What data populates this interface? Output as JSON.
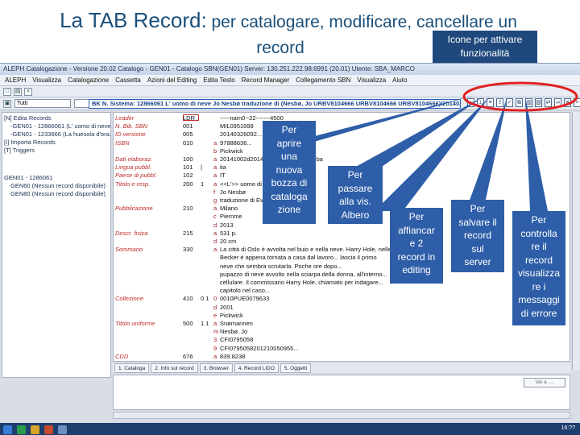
{
  "slide": {
    "title_main": "La TAB Record:",
    "title_rest": " per catalogare, modificare, cancellare un",
    "title_line2": "record",
    "icon_note": "Icone per attivare funzionalità"
  },
  "app": {
    "window_title": "ALEPH Catalogazione - Versione 20.02 Catalogo - GEN01 - Catalogo SBN(GEN01) Server: 130.251.222.98:6991 (20.01) Utente: SBA_MARCO",
    "menu": [
      "ALEPH",
      "Visualizza",
      "Catalogazione",
      "Cassetta",
      "Azioni del Editing",
      "Edita Testo",
      "Record Manager",
      "Collegamento SBN",
      "Visualizza",
      "Aiuto"
    ],
    "base_combo": "Tutti",
    "record_bar": "BK N. Sistema: 12866061 L' uomo di neve Jo Nesbø traduzione di (Nesbø, Jo URBV8104666 URBV8104666 URBV8104666)/20140224) Anno: 2014",
    "toolbar_icons": [
      "new-record-icon",
      "tree-icon",
      "attach-icon",
      "save-icon",
      "check-icon",
      "copy-icon",
      "print-icon",
      "image-icon",
      "transfer-icon",
      "link-icon",
      "delete-icon",
      "close-icon"
    ],
    "tree": {
      "n_edit": "[N] Edita Records",
      "rec1": "-GEN01 - 12866061 (L' uomo di neve /Jo",
      "rec2": "-GEN01 - 1233666 (La huesola d'ora...",
      "import": "[I] Importa Records",
      "triggers": "[T] Triggers",
      "gen_rec": "GEN01 - 1286061",
      "sub1": "GEN60 (Nessun record disponibile)",
      "sub2": "GEN80 (Nessun record disponibile)"
    },
    "rows": [
      {
        "label": "Leader",
        "tag": "LDR",
        "ind": "",
        "sub": "",
        "value": "-----nam0--22-------4500"
      },
      {
        "label": "N. Bib. SBN",
        "tag": "001",
        "ind": "",
        "sub": "",
        "value": "MIL0951999"
      },
      {
        "label": "ID versione",
        "tag": "005",
        "ind": "",
        "sub": "",
        "value": "20140326092..."
      },
      {
        "label": "ISBN",
        "tag": "010",
        "ind": "",
        "sub": "a",
        "value": "97888636..."
      },
      {
        "label": "",
        "tag": "",
        "ind": "",
        "sub": "b",
        "value": "Pickwick"
      },
      {
        "label": "Dati elaboraz.",
        "tag": "100",
        "ind": "",
        "sub": "a",
        "value": "20141002d2014----km-y0itay50------ba"
      },
      {
        "label": "Lingua pubbl.",
        "tag": "101",
        "ind": "|",
        "sub": "a",
        "value": "ita"
      },
      {
        "label": "Paese di pubbl.",
        "tag": "102",
        "ind": "",
        "sub": "a",
        "value": "IT"
      },
      {
        "label": "Titolo e resp.",
        "tag": "200",
        "ind": "1",
        "sub": "a",
        "value": "<<L'>> uomo di neve"
      },
      {
        "label": "",
        "tag": "",
        "ind": "",
        "sub": "f",
        "value": "Jo Nesbø"
      },
      {
        "label": "",
        "tag": "",
        "ind": "",
        "sub": "g",
        "value": "traduzione di Eva Kampmann"
      },
      {
        "label": "Pubblicazione",
        "tag": "210",
        "ind": "",
        "sub": "a",
        "value": "Milano"
      },
      {
        "label": "",
        "tag": "",
        "ind": "",
        "sub": "c",
        "value": "Piemme"
      },
      {
        "label": "",
        "tag": "",
        "ind": "",
        "sub": "d",
        "value": "2013"
      },
      {
        "label": "Descr. fisica",
        "tag": "215",
        "ind": "",
        "sub": "a",
        "value": "531 p."
      },
      {
        "label": "",
        "tag": "",
        "ind": "",
        "sub": "d",
        "value": "20 cm"
      },
      {
        "label": "Sommario",
        "tag": "330",
        "ind": "",
        "sub": "a",
        "value": "La città di Oslo è avvolta nel buio e nella neve. Harry Hole, nelle indagini"
      },
      {
        "label": "",
        "tag": "",
        "ind": "",
        "sub": "",
        "value": "Becker è appena tornata a casa dal lavoro... lascia il primo"
      },
      {
        "label": "",
        "tag": "",
        "ind": "",
        "sub": "",
        "value": "neve che sembra scrutarla. Poche ore dopo..."
      },
      {
        "label": "",
        "tag": "",
        "ind": "",
        "sub": "",
        "value": "pupazzo di neve avvolto nella sciarpa della donna, all'interno..."
      },
      {
        "label": "",
        "tag": "",
        "ind": "",
        "sub": "",
        "value": "cellulare. Il commissario Harry Hole, chiamato per indagare..."
      },
      {
        "label": "",
        "tag": "",
        "ind": "",
        "sub": "",
        "value": "capitolo nel caso..."
      },
      {
        "label": "Collezione",
        "tag": "410",
        "ind": "0 1",
        "sub": "0",
        "value": "0010PUE0079633"
      },
      {
        "label": "",
        "tag": "",
        "ind": "",
        "sub": "d",
        "value": "2001"
      },
      {
        "label": "",
        "tag": "",
        "ind": "",
        "sub": "e",
        "value": "Pickwick"
      },
      {
        "label": "Titolo uniforme",
        "tag": "500",
        "ind": "1 1",
        "sub": "a",
        "value": "Snømannen"
      },
      {
        "label": "",
        "tag": "",
        "ind": "",
        "sub": "m",
        "value": "Nesbø, Jo"
      },
      {
        "label": "",
        "tag": "",
        "ind": "",
        "sub": "3",
        "value": "CFI0795058"
      },
      {
        "label": "",
        "tag": "",
        "ind": "",
        "sub": "9",
        "value": "CFI0795058201210050955..."
      },
      {
        "label": "CDD",
        "tag": "676",
        "ind": "",
        "sub": "a",
        "value": "839.8238"
      }
    ],
    "tabs": [
      "1. Cataloga",
      "2. Info sul record",
      "3. Browser",
      "4. Record LIDO",
      "5. Oggetti"
    ],
    "goto_label": "Vai a ....",
    "clock": "16:??"
  },
  "callouts": [
    {
      "name": "callout-new-record",
      "text": [
        "Per",
        "aprire",
        "una",
        "nuova",
        "bozza di",
        "cataloga",
        "zione"
      ]
    },
    {
      "name": "callout-tree",
      "text": [
        "Per",
        "passare",
        "alla vis.",
        "Albero"
      ]
    },
    {
      "name": "callout-two-records",
      "text": [
        "Per",
        "affiancar",
        "e 2",
        "record in",
        "editing"
      ]
    },
    {
      "name": "callout-save-server",
      "text": [
        "Per",
        "salvare il",
        "record",
        "sul",
        "server"
      ]
    },
    {
      "name": "callout-check",
      "text": [
        "Per",
        "controlla",
        "re il",
        "record",
        "visualizza",
        "re i",
        "messaggi",
        "di errore"
      ]
    }
  ],
  "colors": {
    "callout": "#2e5ea8",
    "title": "#1a4f7a",
    "highlight_oval": "#e02020"
  }
}
